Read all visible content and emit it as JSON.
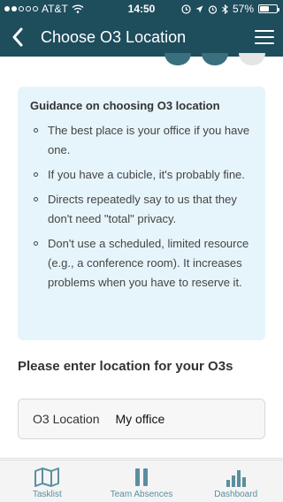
{
  "status_bar": {
    "carrier": "AT&T",
    "time": "14:50",
    "battery_percent": "57%",
    "battery_level": 0.57,
    "signal_bars_filled": 2,
    "signal_bars_total": 5
  },
  "nav": {
    "title": "Choose O3 Location"
  },
  "progress": {
    "steps_total": 3,
    "steps_done": 2
  },
  "guidance": {
    "title": "Guidance on choosing O3 location",
    "items": [
      "The best place is your office if you have one.",
      "If you have a cubicle, it's probably fine.",
      "Directs repeatedly say to us that they don't need \"total\" privacy.",
      "Don't use a scheduled, limited resource (e.g., a conference room). It increases problems when you have to reserve it."
    ]
  },
  "form": {
    "heading": "Please enter location for your O3s",
    "field_label": "O3 Location",
    "field_value": "My office"
  },
  "tabs": [
    {
      "label": "Tasklist",
      "icon": "map-icon"
    },
    {
      "label": "Team Absences",
      "icon": "pause-icon"
    },
    {
      "label": "Dashboard",
      "icon": "bar-chart-icon"
    }
  ],
  "colors": {
    "header_bg": "#1e4d5c",
    "guidance_bg": "#e6f5fb",
    "tab_accent": "#5a8fa0"
  }
}
